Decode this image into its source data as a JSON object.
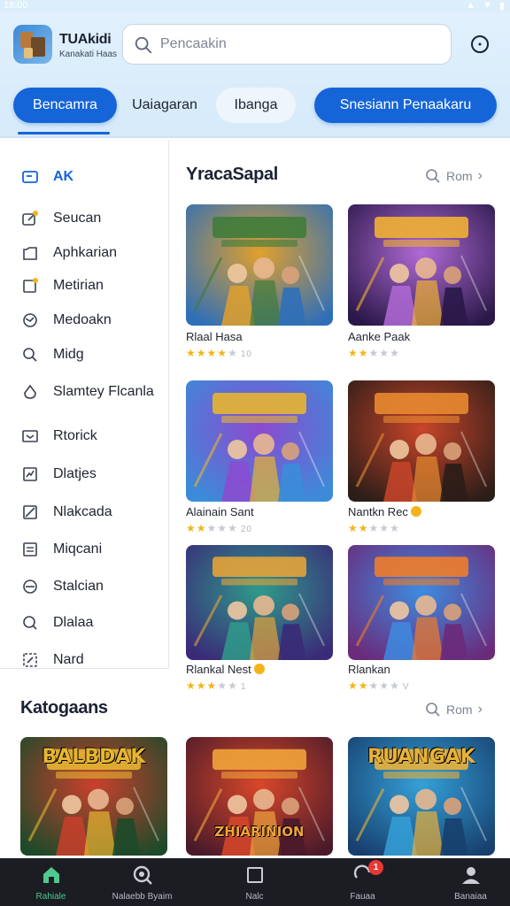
{
  "status_bar": {
    "time": "18:00"
  },
  "app": {
    "name": "TUAkidi",
    "subtitle": "Kanakati Haas"
  },
  "search": {
    "placeholder": "Pencaakin"
  },
  "tabs": [
    {
      "label": "Bencamra",
      "active": true
    },
    {
      "label": "Uaiagaran",
      "active": false
    },
    {
      "label": "Ibanga",
      "active": false
    },
    {
      "label": "Snesiann Penaakaru",
      "active": true
    }
  ],
  "sidebar": {
    "items": [
      {
        "label": "AK",
        "icon": "card-icon",
        "active": true
      },
      {
        "label": "Seucan",
        "icon": "edit-icon",
        "active": false
      },
      {
        "label": "Aphkarian",
        "icon": "folder-icon",
        "active": false
      },
      {
        "label": "Metirian",
        "icon": "note-icon",
        "active": false
      },
      {
        "label": "Medoakn",
        "icon": "globe-icon",
        "active": false
      },
      {
        "label": "Midg",
        "icon": "search-icon",
        "active": false
      },
      {
        "label": "Slamtey Flcanla",
        "icon": "drop-icon",
        "active": false
      },
      {
        "label": "Rtorick",
        "icon": "mail-icon",
        "active": false
      },
      {
        "label": "Dlatjes",
        "icon": "chart-icon",
        "active": false
      },
      {
        "label": "Nlakcada",
        "icon": "image-icon",
        "active": false
      },
      {
        "label": "Miqcani",
        "icon": "list-icon",
        "active": false
      },
      {
        "label": "Stalcian",
        "icon": "compass-icon",
        "active": false
      },
      {
        "label": "Dlalaa",
        "icon": "bubble-icon",
        "active": false
      },
      {
        "label": "Nard",
        "icon": "grid-icon",
        "active": false
      }
    ]
  },
  "popular": {
    "title": "YracaSapal",
    "see_more": "Rom",
    "games": [
      {
        "name": "Rlaal Hasa",
        "stars": 4,
        "rating_text": "10",
        "coin": false,
        "colors": [
          "#2f6fb8",
          "#e0a02c",
          "#3f7c3a"
        ]
      },
      {
        "name": "Aanke Paak",
        "stars": 2,
        "rating_text": "",
        "coin": false,
        "colors": [
          "#2a1848",
          "#b06ad6",
          "#f0b033"
        ]
      },
      {
        "name": "Alainain Sant",
        "stars": 2,
        "rating_text": "20",
        "coin": false,
        "colors": [
          "#3b8cd8",
          "#8c4ad0",
          "#e7b531"
        ]
      },
      {
        "name": "Nantkn Rec",
        "stars": 2,
        "rating_text": "",
        "coin": true,
        "colors": [
          "#2b1d18",
          "#c8452a",
          "#e88a30"
        ]
      },
      {
        "name": "Rlankal Nest",
        "stars": 3,
        "rating_text": "1",
        "coin": true,
        "colors": [
          "#3a2a78",
          "#2f9a8a",
          "#e3a33a"
        ]
      },
      {
        "name": "Rlankan",
        "stars": 2,
        "rating_text": "V",
        "coin": false,
        "colors": [
          "#6b2a7a",
          "#3d8be0",
          "#ef7c2a"
        ]
      }
    ]
  },
  "categories": {
    "title": "Katogaans",
    "see_more": "Rom",
    "games": [
      {
        "name": "BALBDAK",
        "colors": [
          "#1d4a2a",
          "#c9402c",
          "#e7b531"
        ]
      },
      {
        "name": "ZHIARINION",
        "colors": [
          "#4a1a2a",
          "#d8472a",
          "#f0a43a"
        ]
      },
      {
        "name": "RUANGAK",
        "colors": [
          "#17406e",
          "#35a0d8",
          "#e8b13a"
        ]
      }
    ]
  },
  "bottom_nav": [
    {
      "label": "Rahiale",
      "icon": "home-icon",
      "active": true,
      "badge": ""
    },
    {
      "label": "Nalaebb Byaim",
      "icon": "discover-icon",
      "active": false,
      "badge": ""
    },
    {
      "label": "Nalc",
      "icon": "square-icon",
      "active": false,
      "badge": ""
    },
    {
      "label": "Fauaa",
      "icon": "refresh-icon",
      "active": false,
      "badge": "1"
    },
    {
      "label": "Banaiaa",
      "icon": "user-icon",
      "active": false,
      "badge": ""
    }
  ]
}
